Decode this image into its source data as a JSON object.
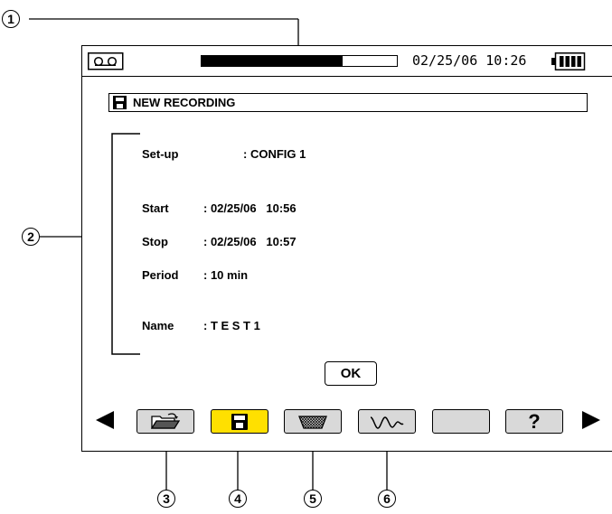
{
  "callouts": [
    "1",
    "2",
    "3",
    "4",
    "5",
    "6"
  ],
  "status_bar": {
    "recording_icon": "cassette-tape-icon",
    "progress": 0.72,
    "datetime": "02/25/06 10:26",
    "battery_icon": "battery-icon"
  },
  "header": {
    "icon": "floppy-disk-icon",
    "title": "NEW RECORDING"
  },
  "fields": {
    "setup": {
      "label": "Set-up",
      "value": ": CONFIG 1"
    },
    "start": {
      "label": "Start",
      "value": ": 02/25/06   10:56"
    },
    "stop": {
      "label": "Stop",
      "value": ": 02/25/06   10:57"
    },
    "period": {
      "label": "Period",
      "value": ": 10 min"
    },
    "name": {
      "label": "Name",
      "value": ": T E S T 1"
    }
  },
  "ok_label": "OK",
  "function_keys": [
    {
      "icon": "open-folder-icon",
      "active": false
    },
    {
      "icon": "floppy-disk-icon",
      "active": true
    },
    {
      "icon": "trash-bin-icon",
      "active": false
    },
    {
      "icon": "waveform-icon",
      "active": false
    },
    {
      "icon": "",
      "active": false
    },
    {
      "icon": "help-icon",
      "label": "?",
      "active": false
    }
  ],
  "nav": {
    "left": "left-arrow-icon",
    "right": "right-arrow-icon"
  },
  "colors": {
    "active_key": "#ffe000",
    "inactive_key": "#d9d9d9"
  }
}
